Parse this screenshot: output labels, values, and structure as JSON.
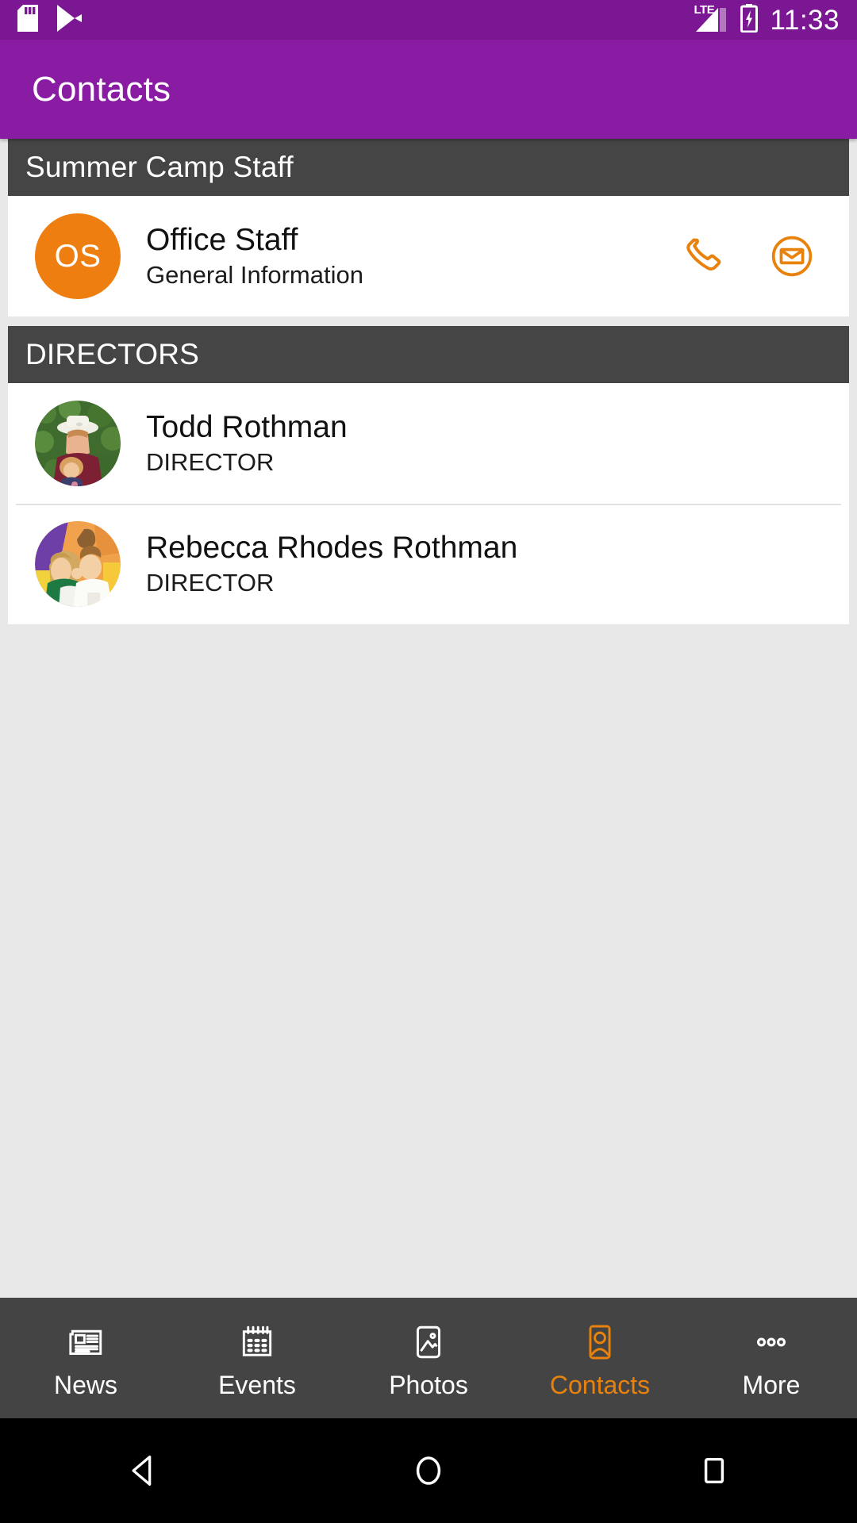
{
  "status_bar": {
    "icons_left": [
      "sd-card-icon",
      "play-store-icon"
    ],
    "network_label": "LTE",
    "battery": "battery-charging-icon",
    "time": "11:33"
  },
  "app_bar": {
    "title": "Contacts",
    "background_color": "#8A1CA3"
  },
  "theme": {
    "accent": "#E8820C",
    "section_header_bg": "#454545",
    "page_bg": "#e8e8e8"
  },
  "sections": [
    {
      "header": "Summer Camp Staff",
      "rows": [
        {
          "avatar_type": "initials",
          "initials": "OS",
          "avatar_color": "#EF7E10",
          "title": "Office Staff",
          "subtitle": "General Information",
          "actions": [
            "phone-icon",
            "email-icon"
          ]
        }
      ]
    },
    {
      "header": "DIRECTORS",
      "rows": [
        {
          "avatar_type": "photo",
          "avatar_alt": "man-in-white-hat-with-child-photo",
          "title": "Todd Rothman",
          "subtitle": "DIRECTOR",
          "actions": []
        },
        {
          "avatar_type": "photo",
          "avatar_alt": "woman-and-child-colorful-background-photo",
          "title": "Rebecca Rhodes Rothman",
          "subtitle": "DIRECTOR",
          "actions": []
        }
      ]
    }
  ],
  "tab_bar": {
    "tabs": [
      {
        "label": "News",
        "icon": "newspaper-icon",
        "active": false
      },
      {
        "label": "Events",
        "icon": "calendar-icon",
        "active": false
      },
      {
        "label": "Photos",
        "icon": "photo-icon",
        "active": false
      },
      {
        "label": "Contacts",
        "icon": "contact-card-icon",
        "active": true
      },
      {
        "label": "More",
        "icon": "more-dots-icon",
        "active": false
      }
    ]
  },
  "nav_bar": {
    "buttons": [
      "back-icon",
      "home-icon",
      "recents-icon"
    ]
  }
}
